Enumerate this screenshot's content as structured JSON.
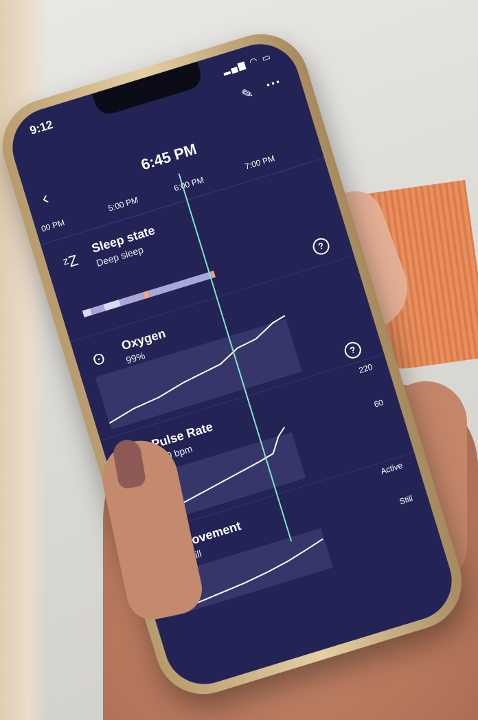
{
  "status": {
    "time": "9:12"
  },
  "header": {
    "title": "6:45 PM"
  },
  "timeline": {
    "ticks": [
      "00 PM",
      "5:00 PM",
      "6:00 PM",
      "7:00 PM"
    ]
  },
  "sections": {
    "sleep": {
      "title": "Sleep state",
      "value": "Deep sleep",
      "icon": "zzz-icon"
    },
    "oxygen": {
      "title": "Oxygen",
      "value": "99%",
      "icon": "lungs-icon"
    },
    "pulse": {
      "title": "Pulse Rate",
      "value": "150 bpm",
      "icon": "heart-icon",
      "axis_high": "220",
      "axis_low": "60"
    },
    "movement": {
      "title": "Movement",
      "value": "Still",
      "icon": "footprint-icon",
      "axis_high": "Active",
      "axis_low": "Still"
    }
  },
  "colors": {
    "screen_bg": "#242355",
    "accent_cursor": "#7fe3c9",
    "sleep_deep": "#a9a6d8",
    "sleep_light": "#dcdaf2",
    "sleep_awake": "#f0a77d"
  },
  "sleep_segments": [
    {
      "state": "light",
      "fraction": 0.06
    },
    {
      "state": "deep",
      "fraction": 0.1
    },
    {
      "state": "light",
      "fraction": 0.12
    },
    {
      "state": "deep",
      "fraction": 0.18
    },
    {
      "state": "awake",
      "fraction": 0.04
    },
    {
      "state": "deep",
      "fraction": 0.48
    },
    {
      "state": "awake",
      "fraction": 0.02
    }
  ]
}
